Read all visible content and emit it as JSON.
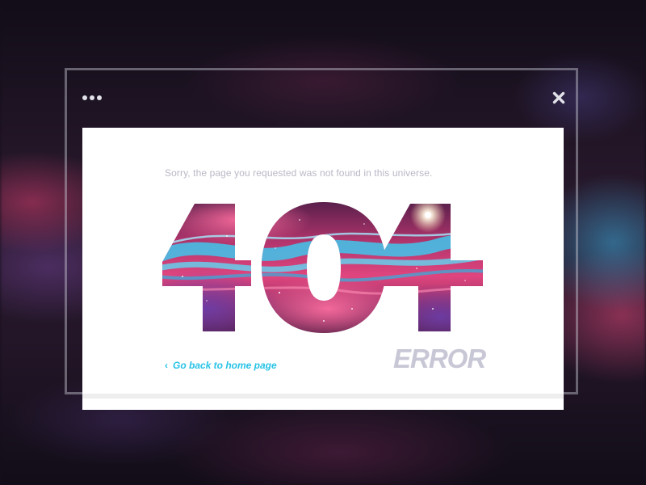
{
  "window": {
    "menu_icon": "more-dots-icon",
    "close_icon": "close-x-icon"
  },
  "content": {
    "message": "Sorry, the page you requested was not found in this universe.",
    "code": "404",
    "error_label": "ERROR",
    "back_link": {
      "icon": "chevron-left-icon",
      "chevron": "‹",
      "label": "Go back to home page"
    }
  },
  "colors": {
    "link": "#27c3e6",
    "error_label": "#c8c7d6",
    "message": "#b8b8c6",
    "card": "#ffffff",
    "nebula_pink": "#e0457e",
    "nebula_cyan": "#3fc7ec",
    "nebula_deep": "#2a0f2e"
  }
}
